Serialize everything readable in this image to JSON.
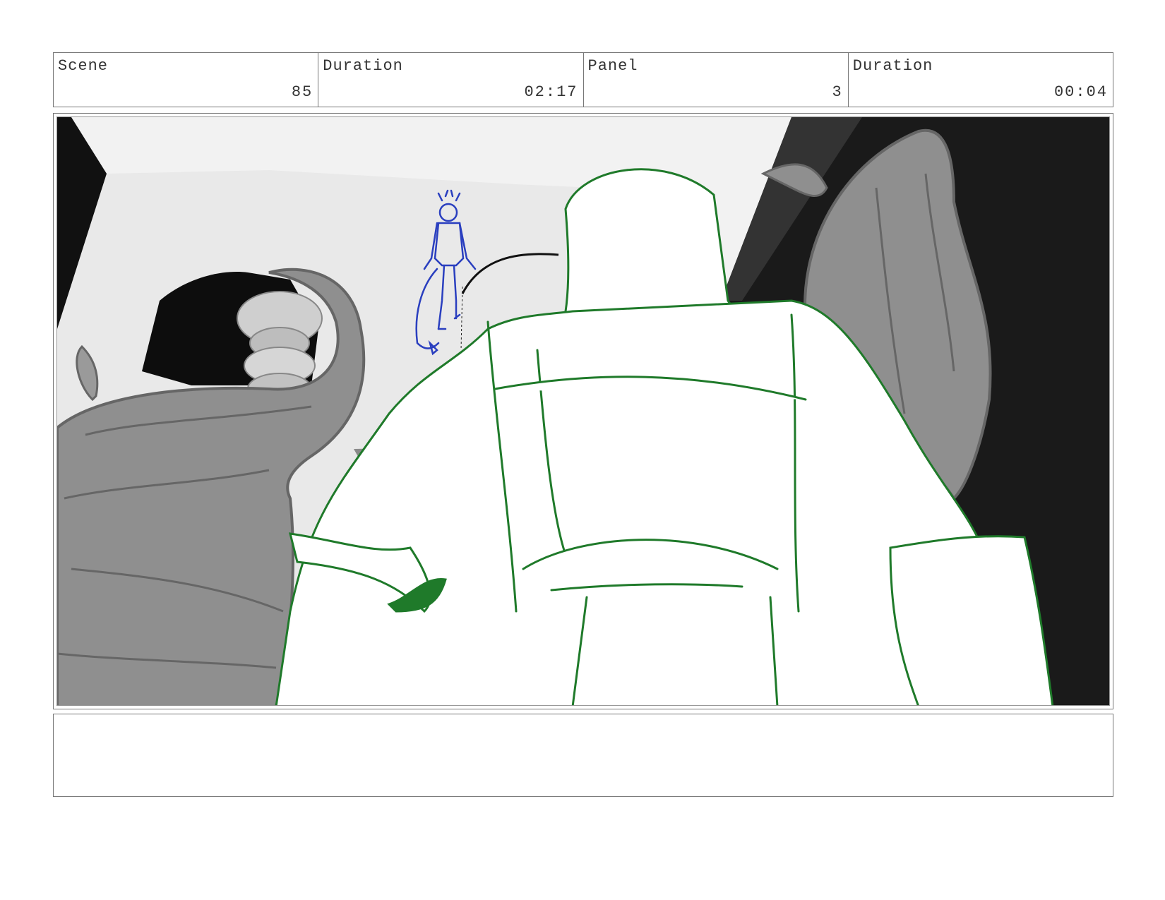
{
  "header": {
    "scene_label": "Scene",
    "scene_value": "85",
    "scene_duration_label": "Duration",
    "scene_duration_value": "02:17",
    "panel_label": "Panel",
    "panel_value": "3",
    "panel_duration_label": "Duration",
    "panel_duration_value": "00:04"
  },
  "colors": {
    "sketch_green": "#1f7a2a",
    "sketch_blue": "#2a3fbf",
    "leaf_gray": "#8f8f8f",
    "shadow_dark": "#1a1a1a"
  },
  "notes": {
    "text": ""
  }
}
